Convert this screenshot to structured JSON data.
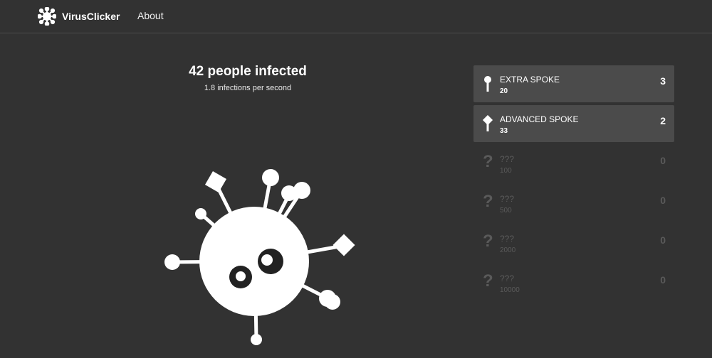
{
  "nav": {
    "brand_icon": "virus-icon",
    "brand_name": "VirusClicker",
    "about_label": "About"
  },
  "counter": {
    "infected_text": "42 people infected",
    "rate_text": "1.8 infections per second"
  },
  "shop": {
    "items": [
      {
        "name": "EXTRA SPOKE",
        "cost": "20",
        "count": "3",
        "icon": "spoke-round-icon",
        "locked": false
      },
      {
        "name": "ADVANCED SPOKE",
        "cost": "33",
        "count": "2",
        "icon": "spoke-diamond-icon",
        "locked": false
      },
      {
        "name": "???",
        "cost": "100",
        "count": "0",
        "icon": "question-mark-icon",
        "locked": true
      },
      {
        "name": "???",
        "cost": "500",
        "count": "0",
        "icon": "question-mark-icon",
        "locked": true
      },
      {
        "name": "???",
        "cost": "2000",
        "count": "0",
        "icon": "question-mark-icon",
        "locked": true
      },
      {
        "name": "???",
        "cost": "10000",
        "count": "0",
        "icon": "question-mark-icon",
        "locked": true
      }
    ]
  },
  "colors": {
    "background": "#323232",
    "shop_item_bg": "#4b4b4b",
    "locked_text": "#5a5a5a",
    "virus": "#ffffff"
  }
}
